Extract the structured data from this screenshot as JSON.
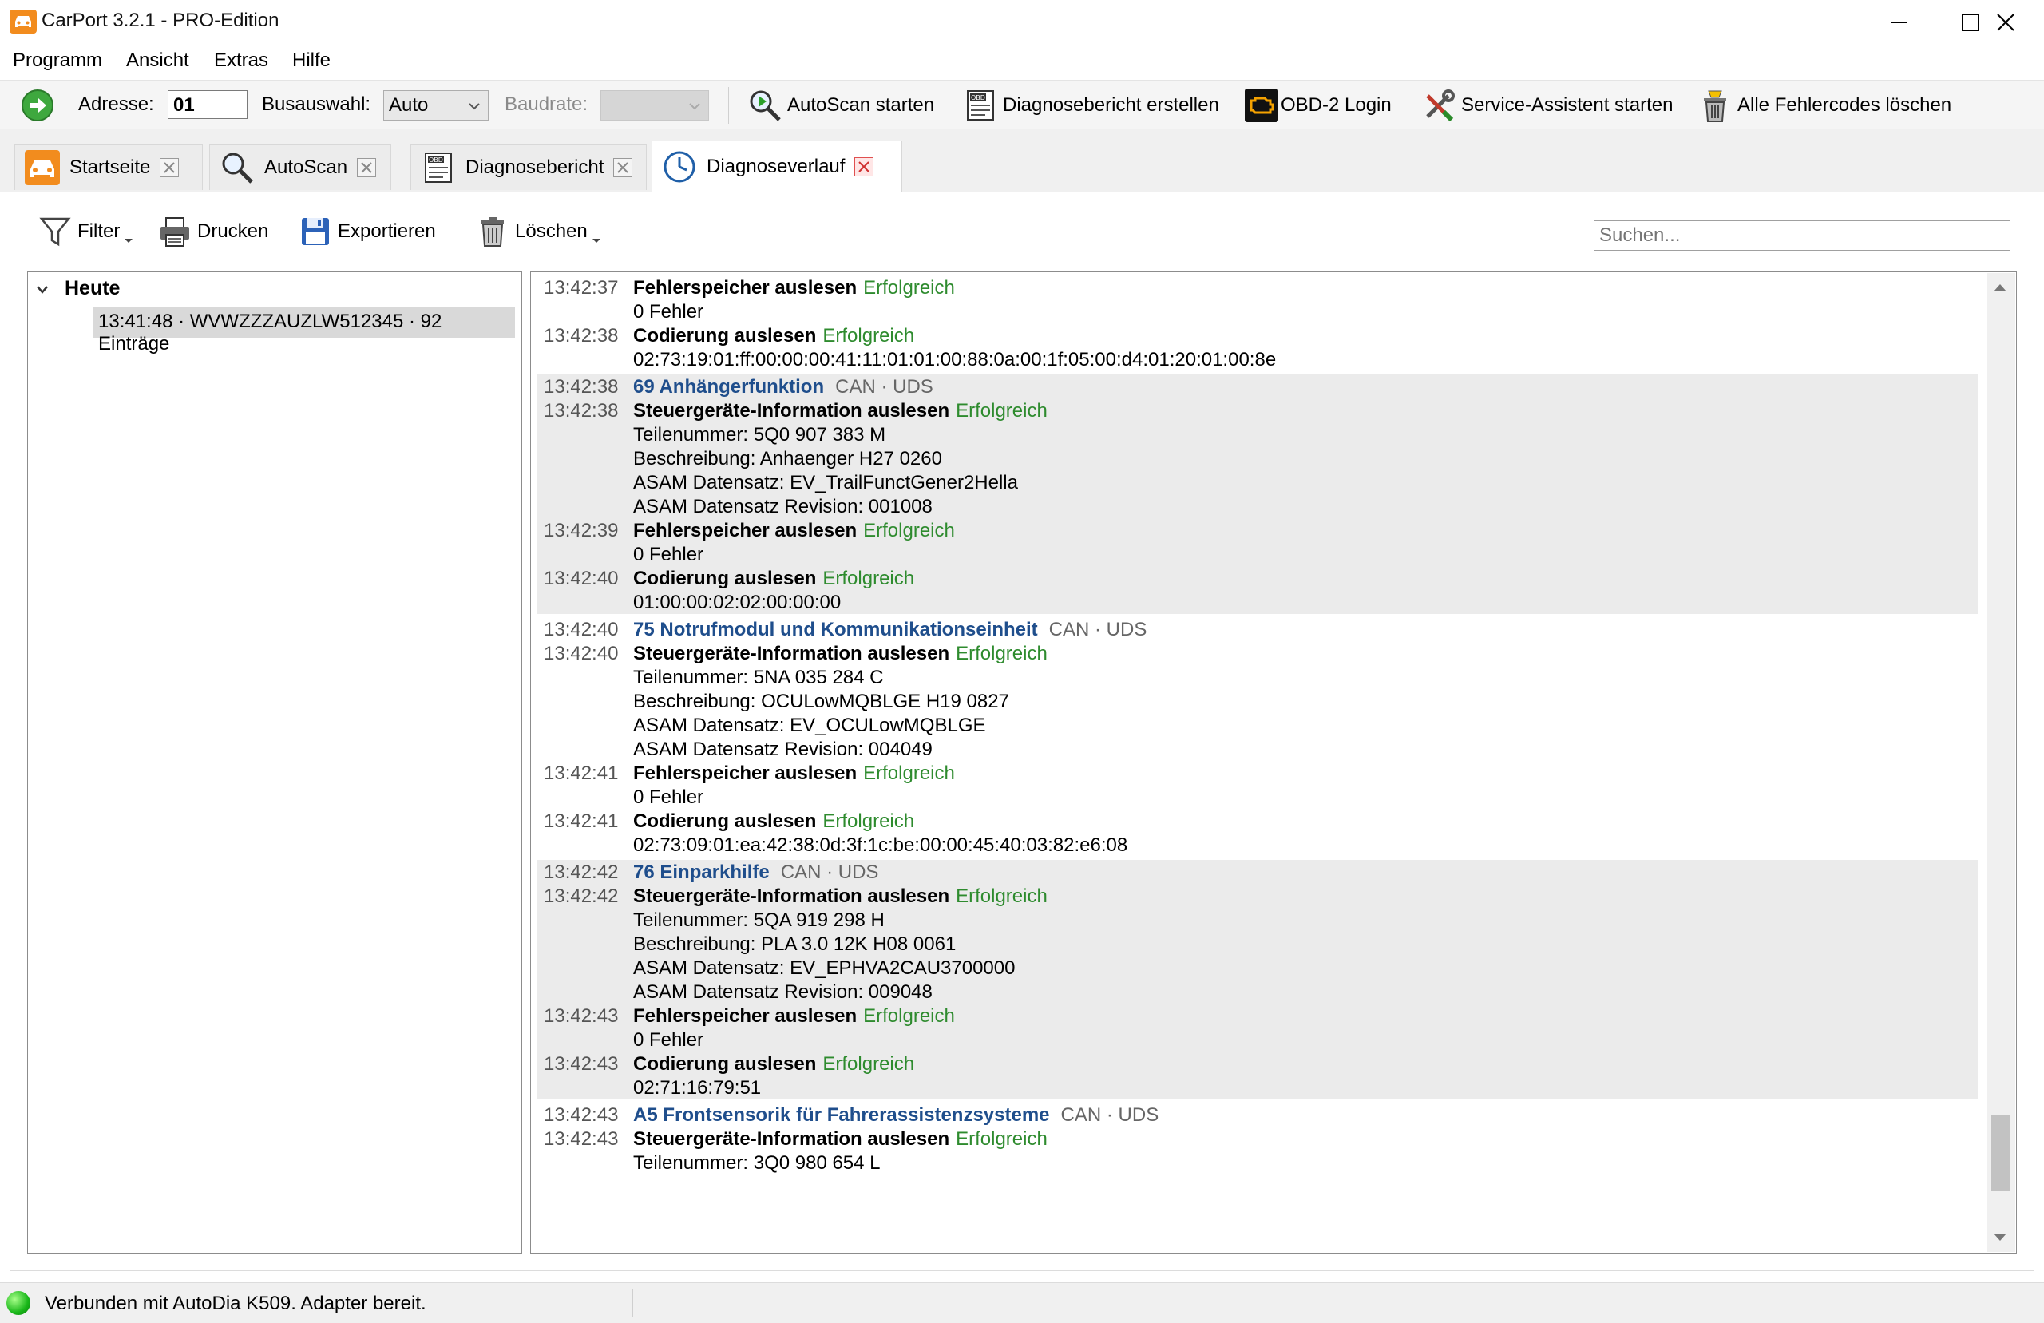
{
  "window": {
    "title": "CarPort 3.2.1 - PRO-Edition"
  },
  "menu": [
    "Programm",
    "Ansicht",
    "Extras",
    "Hilfe"
  ],
  "toolbar": {
    "address_label": "Adresse:",
    "address_value": "01",
    "bus_label": "Busauswahl:",
    "bus_value": "Auto",
    "baud_label": "Baudrate:",
    "baud_value": "",
    "autoscan": "AutoScan starten",
    "report": "Diagnosebericht erstellen",
    "obd_login": "OBD-2 Login",
    "service": "Service-Assistent starten",
    "clear_codes": "Alle Fehlercodes löschen"
  },
  "tabs": [
    {
      "label": "Startseite"
    },
    {
      "label": "AutoScan"
    },
    {
      "label": "Diagnosebericht"
    },
    {
      "label": "Diagnoseverlauf"
    }
  ],
  "actions": {
    "filter": "Filter",
    "print": "Drucken",
    "export": "Exportieren",
    "delete": "Löschen",
    "search_placeholder": "Suchen..."
  },
  "tree": {
    "root": "Heute",
    "entry": "13:41:48 · WVWZZZAUZLW512345 · 92 Einträge"
  },
  "log": {
    "groups": [
      {
        "shaded": false,
        "lines": [
          {
            "ts": "13:42:37",
            "title": "Fehlerspeicher auslesen",
            "status": "Erfolgreich"
          },
          {
            "ts": "",
            "text": "0 Fehler"
          },
          {
            "ts": "13:42:38",
            "title": "Codierung auslesen",
            "status": "Erfolgreich"
          },
          {
            "ts": "",
            "text": "02:73:19:01:ff:00:00:00:41:11:01:01:00:88:0a:00:1f:05:00:d4:01:20:01:00:8e"
          }
        ]
      },
      {
        "shaded": true,
        "lines": [
          {
            "ts": "13:42:38",
            "module": "69 Anhängerfunktion",
            "proto": "CAN · UDS"
          },
          {
            "ts": "13:42:38",
            "title": "Steuergeräte-Information auslesen",
            "status": "Erfolgreich"
          },
          {
            "ts": "",
            "text": "Teilenummer: 5Q0 907 383 M"
          },
          {
            "ts": "",
            "text": "Beschreibung: Anhaenger H27 0260"
          },
          {
            "ts": "",
            "text": "ASAM Datensatz: EV_TrailFunctGener2Hella"
          },
          {
            "ts": "",
            "text": "ASAM Datensatz Revision: 001008"
          },
          {
            "ts": "13:42:39",
            "title": "Fehlerspeicher auslesen",
            "status": "Erfolgreich"
          },
          {
            "ts": "",
            "text": "0 Fehler"
          },
          {
            "ts": "13:42:40",
            "title": "Codierung auslesen",
            "status": "Erfolgreich"
          },
          {
            "ts": "",
            "text": "01:00:00:02:02:00:00:00"
          }
        ]
      },
      {
        "shaded": false,
        "lines": [
          {
            "ts": "13:42:40",
            "module": "75 Notrufmodul und Kommunikationseinheit",
            "proto": "CAN · UDS"
          },
          {
            "ts": "13:42:40",
            "title": "Steuergeräte-Information auslesen",
            "status": "Erfolgreich"
          },
          {
            "ts": "",
            "text": "Teilenummer: 5NA 035 284 C"
          },
          {
            "ts": "",
            "text": "Beschreibung: OCULowMQBLGE H19 0827"
          },
          {
            "ts": "",
            "text": "ASAM Datensatz: EV_OCULowMQBLGE"
          },
          {
            "ts": "",
            "text": "ASAM Datensatz Revision: 004049"
          },
          {
            "ts": "13:42:41",
            "title": "Fehlerspeicher auslesen",
            "status": "Erfolgreich"
          },
          {
            "ts": "",
            "text": "0 Fehler"
          },
          {
            "ts": "13:42:41",
            "title": "Codierung auslesen",
            "status": "Erfolgreich"
          },
          {
            "ts": "",
            "text": "02:73:09:01:ea:42:38:0d:3f:1c:be:00:00:45:40:03:82:e6:08"
          }
        ]
      },
      {
        "shaded": true,
        "lines": [
          {
            "ts": "13:42:42",
            "module": "76 Einparkhilfe",
            "proto": "CAN · UDS"
          },
          {
            "ts": "13:42:42",
            "title": "Steuergeräte-Information auslesen",
            "status": "Erfolgreich"
          },
          {
            "ts": "",
            "text": "Teilenummer: 5QA 919 298 H"
          },
          {
            "ts": "",
            "text": "Beschreibung: PLA 3.0 12K H08 0061"
          },
          {
            "ts": "",
            "text": "ASAM Datensatz: EV_EPHVA2CAU3700000"
          },
          {
            "ts": "",
            "text": "ASAM Datensatz Revision: 009048"
          },
          {
            "ts": "13:42:43",
            "title": "Fehlerspeicher auslesen",
            "status": "Erfolgreich"
          },
          {
            "ts": "",
            "text": "0 Fehler"
          },
          {
            "ts": "13:42:43",
            "title": "Codierung auslesen",
            "status": "Erfolgreich"
          },
          {
            "ts": "",
            "text": "02:71:16:79:51"
          }
        ]
      },
      {
        "shaded": false,
        "lines": [
          {
            "ts": "13:42:43",
            "module": "A5 Frontsensorik für Fahrerassistenzsysteme",
            "proto": "CAN · UDS"
          },
          {
            "ts": "13:42:43",
            "title": "Steuergeräte-Information auslesen",
            "status": "Erfolgreich"
          },
          {
            "ts": "",
            "text": "Teilenummer: 3Q0 980 654 L"
          }
        ]
      }
    ]
  },
  "status": {
    "text": "Verbunden mit AutoDia K509. Adapter bereit."
  },
  "colors": {
    "success": "#2e8b2e",
    "module": "#1f4e8c",
    "accent": "#f28c1e",
    "led": "#19b719"
  }
}
